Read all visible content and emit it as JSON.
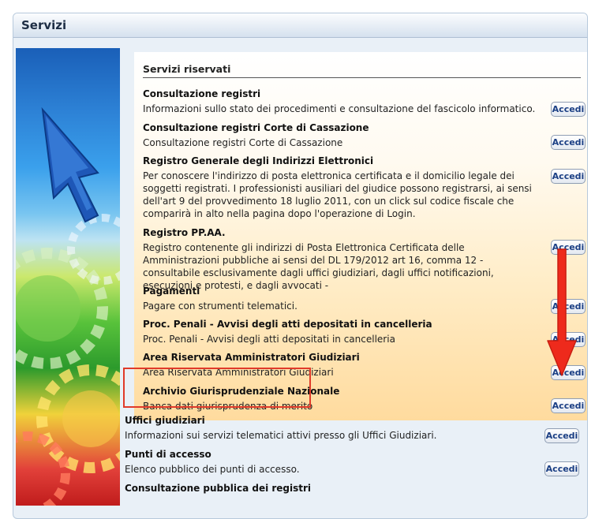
{
  "panel": {
    "title": "Servizi"
  },
  "reserved": {
    "title": "Servizi riservati",
    "items": [
      {
        "title": "Consultazione registri",
        "desc": "Informazioni sullo stato dei procedimenti e consultazione del fascicolo informatico.",
        "button": "Accedi"
      },
      {
        "title": "Consultazione registri Corte di Cassazione",
        "desc": "Consultazione registri Corte di Cassazione",
        "button": "Accedi"
      },
      {
        "title": "Registro Generale degli Indirizzi Elettronici",
        "desc": "Per conoscere l'indirizzo di posta elettronica certificata e il domicilio legale dei soggetti registrati. I professionisti ausiliari del giudice possono registrarsi, ai sensi dell'art 9 del provvedimento 18 luglio 2011, con un click sul codice fiscale che comparirà in alto nella pagina dopo l'operazione di Login.",
        "button": "Accedi"
      },
      {
        "title": "Registro PP.AA.",
        "desc": "Registro contenente gli indirizzi di Posta Elettronica Certificata delle Amministrazioni pubbliche ai sensi del DL 179/2012 art 16, comma 12 - consultabile esclusivamente dagli uffici giudiziari, dagli uffici notificazioni, esecuzioni e protesti, e dagli avvocati -",
        "button": "Accedi"
      },
      {
        "title": "Pagamenti",
        "desc": "Pagare con strumenti telematici.",
        "button": "Accedi"
      },
      {
        "title": "Proc. Penali - Avvisi degli atti depositati in cancelleria",
        "desc": "Proc. Penali - Avvisi degli atti depositati in cancelleria",
        "button": "Accedi"
      },
      {
        "title": "Area Riservata Amministratori Giudiziari",
        "desc": "Area Riservata Amministratori Giudiziari",
        "button": "Accedi"
      },
      {
        "title": "Archivio Giurisprudenziale Nazionale",
        "desc": "Banca dati giurisprudenza di merito",
        "button": "Accedi"
      }
    ]
  },
  "public": [
    {
      "title": "Uffici giudiziari",
      "desc": "Informazioni sui servizi telematici attivi presso gli Uffici Giudiziari.",
      "button": "Accedi"
    },
    {
      "title": "Punti di accesso",
      "desc": "Elenco pubblico dei punti di accesso.",
      "button": "Accedi"
    },
    {
      "title": "Consultazione pubblica dei registri"
    }
  ],
  "colors": {
    "annotation": "#e03a2a",
    "button_text": "#1b3f84"
  }
}
